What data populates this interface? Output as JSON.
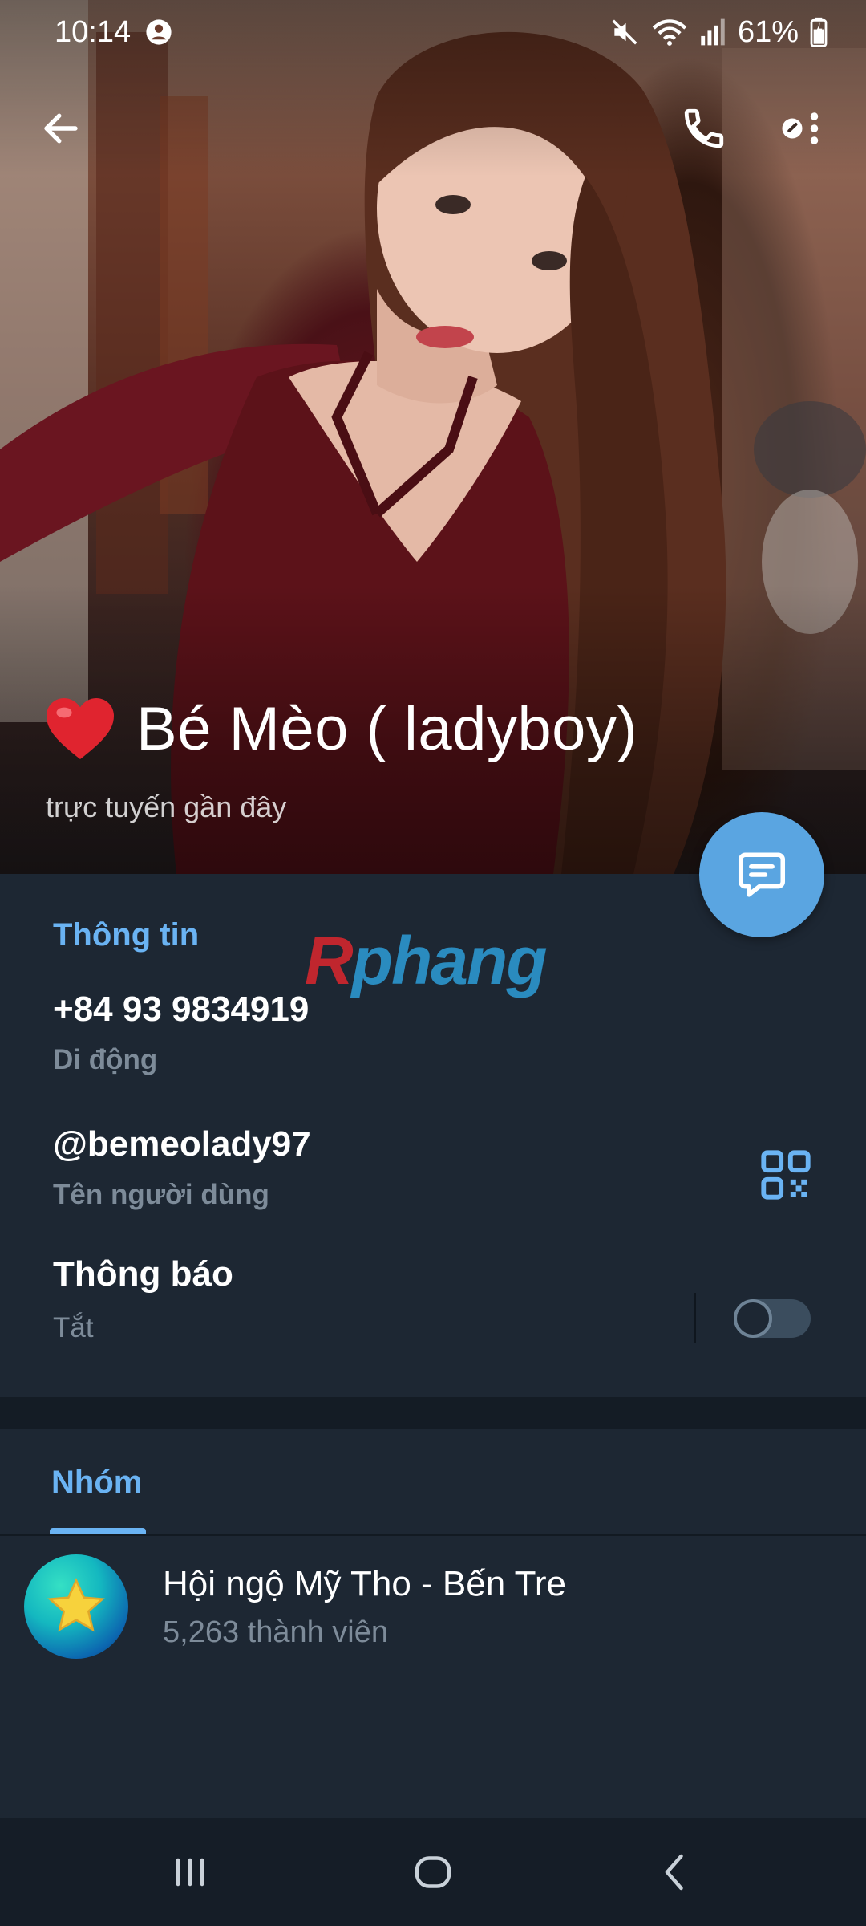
{
  "status_bar": {
    "time": "10:14",
    "battery_percent": "61%",
    "icons": [
      "account-circle-icon",
      "mute-icon",
      "wifi-icon",
      "signal-icon",
      "battery-icon"
    ]
  },
  "top_bar": {
    "back_icon": "arrow-left-icon",
    "call_icon": "phone-icon",
    "more_icon": "more-options-icon"
  },
  "profile": {
    "name": "Bé Mèo ( ladyboy)",
    "name_emoji_icon": "red-heart-icon",
    "last_seen": "trực tuyến gần đây",
    "fab_icon": "message-icon"
  },
  "watermark": {
    "first_letter": "R",
    "rest": "phang"
  },
  "info": {
    "section_title": "Thông tin",
    "phone": {
      "value": "+84 93 9834919",
      "label": "Di động"
    },
    "username": {
      "value": "@bemeolady97",
      "label": "Tên người dùng",
      "action_icon": "qr-code-icon"
    },
    "notifications": {
      "title": "Thông báo",
      "status": "Tắt",
      "enabled": false
    }
  },
  "groups": {
    "tab_label": "Nhóm",
    "items": [
      {
        "name": "Hội ngộ Mỹ Tho - Bến Tre",
        "members": "5,263 thành viên",
        "avatar_icon": "star-icon"
      }
    ]
  },
  "nav_bar": {
    "recents_icon": "recents-icon",
    "home_icon": "home-icon",
    "back_icon": "nav-back-icon"
  },
  "colors": {
    "background": "#1d2733",
    "accent": "#6ab3f3",
    "fab": "#5aa5e1",
    "secondary_text": "#7d8b99",
    "navbar": "#151d27"
  }
}
